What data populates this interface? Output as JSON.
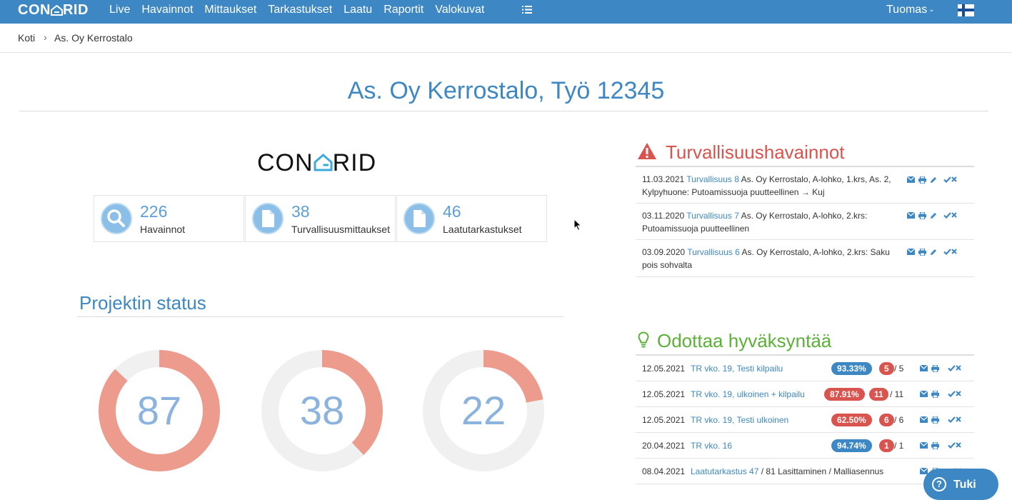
{
  "nav": {
    "brand": "CONGRID",
    "items": [
      "Live",
      "Havainnot",
      "Mittaukset",
      "Tarkastukset",
      "Laatu",
      "Raportit",
      "Valokuvat"
    ],
    "list_icon": "list-icon",
    "user": "Tuomas",
    "flag": "finland-flag-icon"
  },
  "breadcrumb": {
    "home": "Koti",
    "separator": "›",
    "current": "As. Oy Kerrostalo"
  },
  "page": {
    "title": "As. Oy Kerrostalo, Työ 12345"
  },
  "logo": {
    "text_left": "CON",
    "text_right": "RID"
  },
  "stats": [
    {
      "value": "226",
      "label": "Havainnot",
      "icon": "search-icon"
    },
    {
      "value": "38",
      "label": "Turvallisuusmittaukset",
      "icon": "document-icon"
    },
    {
      "value": "46",
      "label": "Laatutarkastukset",
      "icon": "document-icon"
    }
  ],
  "status": {
    "title": "Projektin status",
    "donuts": [
      {
        "value": "87",
        "percent": 87
      },
      {
        "value": "38",
        "percent": 38
      },
      {
        "value": "22",
        "percent": 22
      }
    ]
  },
  "safety": {
    "title": "Turvallisuushavainnot",
    "rows": [
      {
        "date": "11.03.2021",
        "link": "Turvallisuus 8",
        "text": "As. Oy Kerrostalo, A-lohko, 1.krs, As. 2, Kylpyhuone: Putoamissuoja puutteellinen → Kuj"
      },
      {
        "date": "03.11.2020",
        "link": "Turvallisuus 7",
        "text": "As. Oy Kerrostalo, A-lohko, 2.krs: Putoamissuoja puutteellinen"
      },
      {
        "date": "03.09.2020",
        "link": "Turvallisuus 6",
        "text": "As. Oy Kerrostalo, A-lohko, 2.krs: Saku pois sohvalta"
      }
    ]
  },
  "approval": {
    "title": "Odottaa hyväksyntää",
    "rows": [
      {
        "date": "12.05.2021",
        "link": "TR vko. 19, Testi kilpailu",
        "percent": "93.33%",
        "percent_color": "#3d87c4",
        "count": "5",
        "total": "/ 5"
      },
      {
        "date": "12.05.2021",
        "link": "TR vko. 19, ulkoinen + kilpailu",
        "percent": "87.91%",
        "percent_color": "#d9534f",
        "count": "11",
        "total": "/ 11"
      },
      {
        "date": "12.05.2021",
        "link": "TR vko. 19, Testi ulkoinen",
        "percent": "62.50%",
        "percent_color": "#d9534f",
        "count": "6",
        "total": "/ 6"
      },
      {
        "date": "20.04.2021",
        "link": "TR vko. 16",
        "percent": "94.74%",
        "percent_color": "#3d87c4",
        "count": "1",
        "total": "/ 1"
      },
      {
        "date": "08.04.2021",
        "link": "Laatutarkastus 47",
        "suffix": "/ 81 Lasittaminen / Malliasennus"
      }
    ]
  },
  "support": {
    "label": "Tuki",
    "icon": "question-icon"
  },
  "colors": {
    "brand_blue": "#3d87c4",
    "danger": "#d9534f",
    "success": "#5cb038",
    "donut": "#ec9b8c"
  }
}
